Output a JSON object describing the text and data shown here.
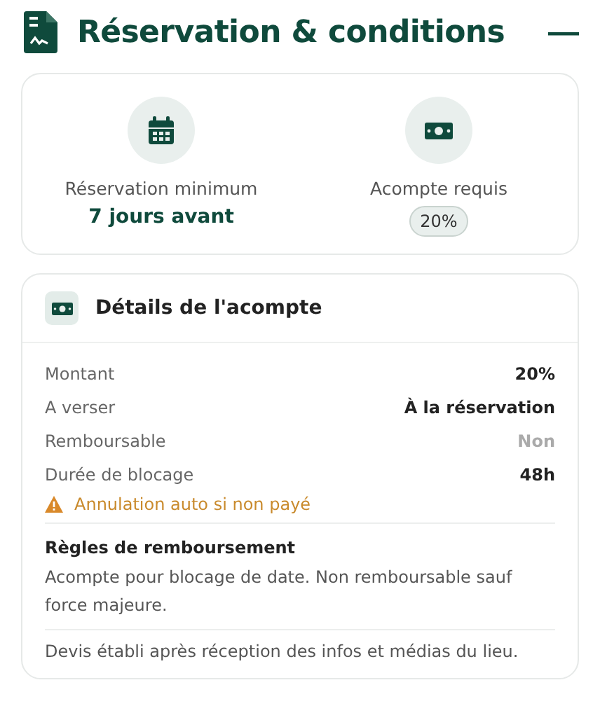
{
  "header": {
    "title": "Réservation & conditions",
    "collapse": "—"
  },
  "summary": [
    {
      "kind": "calendar",
      "label": "Réservation minimum",
      "value": "7 jours avant"
    },
    {
      "kind": "money",
      "label": "Acompte requis",
      "value": "20%"
    }
  ],
  "details": {
    "title": "Détails de l'acompte",
    "rows": [
      {
        "label": "Montant",
        "value": "20%",
        "muted": false
      },
      {
        "label": "A verser",
        "value": "À la réservation",
        "muted": false
      },
      {
        "label": "Remboursable",
        "value": "Non",
        "muted": true
      },
      {
        "label": "Durée de blocage",
        "value": "48h",
        "muted": false
      }
    ],
    "warning": "Annulation auto si non payé",
    "rules_title": "Règles de remboursement",
    "rules_text": "Acompte pour blocage de date. Non remboursable sauf force majeure.",
    "footer": "Devis établi après réception des infos et médias du lieu."
  }
}
